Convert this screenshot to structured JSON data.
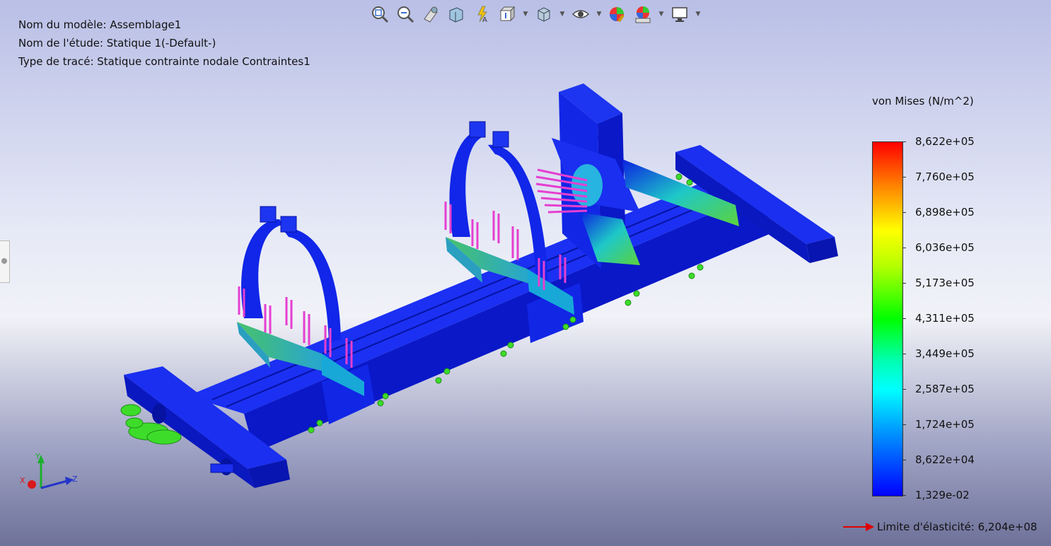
{
  "info": {
    "model": "Nom du modèle: Assemblage1",
    "study": "Nom de l'étude: Statique 1(-Default-)",
    "plot": "Type de tracé: Statique contrainte nodale Contraintes1"
  },
  "toolbar": {
    "icons": [
      "zoom-to-fit-icon",
      "zoom-area-icon",
      "previous-view-icon",
      "section-view-icon",
      "dynamic-annotation-icon",
      "view-orientation-icon",
      "display-style-icon",
      "hide-show-icon",
      "edit-appearance-icon",
      "apply-scene-icon",
      "view-settings-icon"
    ]
  },
  "legend": {
    "title": "von Mises (N/m^2)",
    "ticks": [
      "8,622e+05",
      "7,760e+05",
      "6,898e+05",
      "6,036e+05",
      "5,173e+05",
      "4,311e+05",
      "3,449e+05",
      "2,587e+05",
      "1,724e+05",
      "8,622e+04",
      "1,329e-02"
    ]
  },
  "yield": {
    "text": "Limite d'élasticité: 6,204e+08",
    "arrow_color": "#e00000"
  },
  "triad": {
    "x": "X",
    "y": "Y",
    "z": "Z"
  },
  "colors": {
    "base_stress": "#0a18e8",
    "load_arrows": "#e53fd0",
    "fixtures": "#3ddc2a"
  }
}
